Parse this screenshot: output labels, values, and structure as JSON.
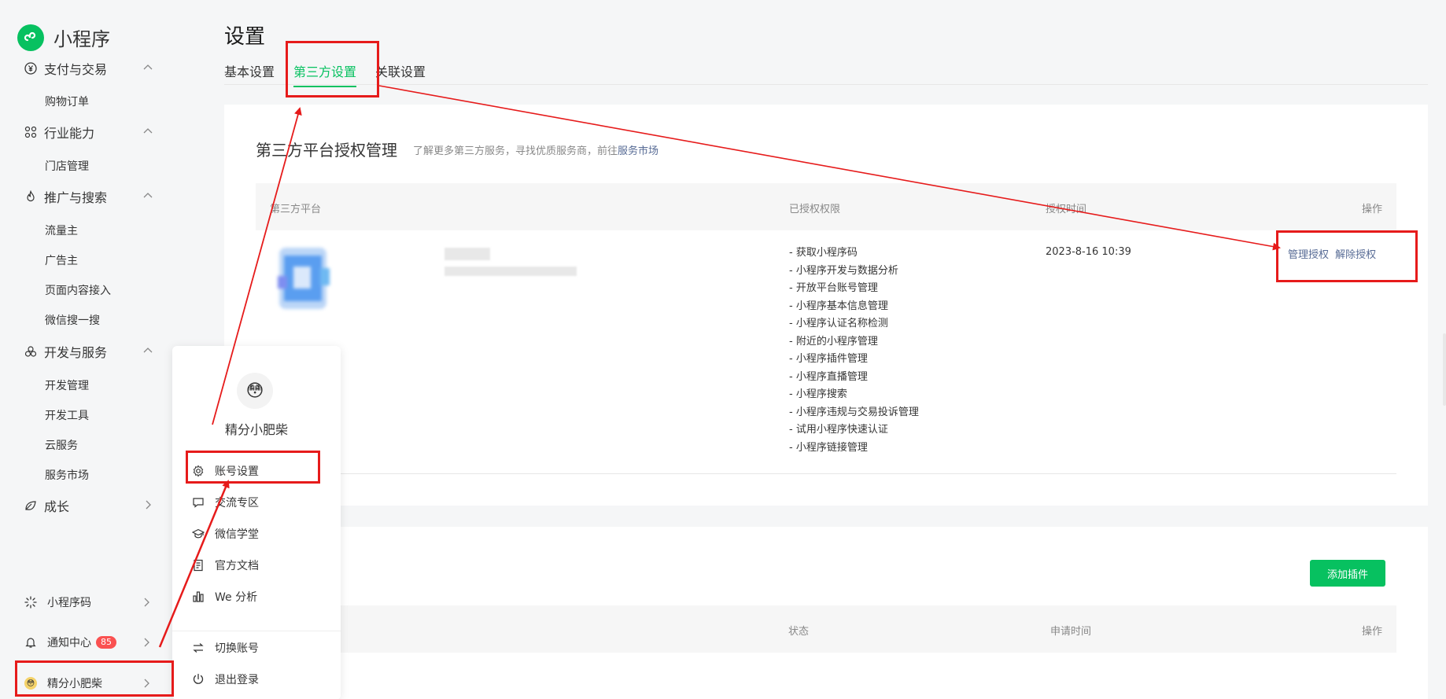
{
  "app": {
    "title": "小程序",
    "brand_color": "#07c160"
  },
  "sidebar": {
    "groups": [
      {
        "label": "支付与交易",
        "icon": "yen-circle-icon",
        "items": [
          "购物订单"
        ]
      },
      {
        "label": "行业能力",
        "icon": "cluster-icon",
        "items": [
          "门店管理"
        ]
      },
      {
        "label": "推广与搜索",
        "icon": "flame-icon",
        "items": [
          "流量主",
          "广告主",
          "页面内容接入",
          "微信搜一搜"
        ]
      },
      {
        "label": "开发与服务",
        "icon": "dev-circles-icon",
        "items": [
          "开发管理",
          "开发工具",
          "云服务",
          "服务市场"
        ]
      },
      {
        "label": "成长",
        "icon": "leaf-icon",
        "items": []
      }
    ],
    "bottom": {
      "qrcode_label": "小程序码",
      "notify_label": "通知中心",
      "notify_count": "85",
      "account_label": "精分小肥柴"
    }
  },
  "page": {
    "title": "设置",
    "tabs": [
      "基本设置",
      "第三方设置",
      "关联设置"
    ],
    "active_tab": 1
  },
  "auth_section": {
    "title": "第三方平台授权管理",
    "desc_prefix": "了解更多第三方服务，寻找优质服务商，前往",
    "desc_link": "服务市场",
    "columns": [
      "第三方平台",
      "已授权权限",
      "授权时间",
      "操作"
    ],
    "row": {
      "permissions": [
        "- 获取小程序码",
        "- 小程序开发与数据分析",
        "- 开放平台账号管理",
        "- 小程序基本信息管理",
        "- 小程序认证名称检测",
        "- 附近的小程序管理",
        "- 小程序插件管理",
        "- 小程序直播管理",
        "- 小程序搜索",
        "- 小程序违规与交易投诉管理",
        "- 试用小程序快速认证",
        "- 小程序链接管理"
      ],
      "auth_time": "2023-8-16 10:39",
      "op_manage": "管理授权",
      "op_revoke": "解除授权"
    }
  },
  "plugin_section": {
    "add_button": "添加插件",
    "columns": [
      "状态",
      "申请时间",
      "操作"
    ]
  },
  "popup": {
    "avatar_emoji": "😳",
    "name": "精分小肥柴",
    "items": [
      {
        "label": "账号设置",
        "icon": "gear-icon"
      },
      {
        "label": "交流专区",
        "icon": "chat-icon"
      },
      {
        "label": "微信学堂",
        "icon": "graduation-cap-icon"
      },
      {
        "label": "官方文档",
        "icon": "document-icon"
      },
      {
        "label": "We 分析",
        "icon": "bar-analysis-icon"
      },
      {
        "label": "切换账号",
        "icon": "switch-arrows-icon"
      },
      {
        "label": "退出登录",
        "icon": "power-icon"
      }
    ]
  },
  "annotation_color": "#e61b1b"
}
